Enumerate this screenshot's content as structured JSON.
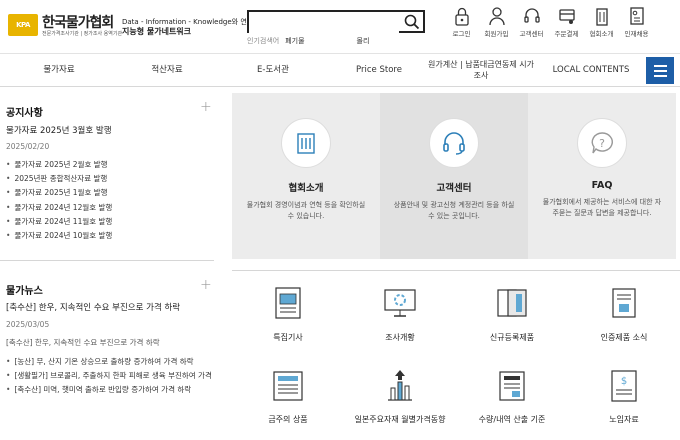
{
  "header": {
    "logo_badge": "사단법인",
    "logo_small": "사단법인",
    "logo_main": "한국물가협회",
    "logo_sub": "전문가격조사기관 | 정가조사 용역기관",
    "tagline_1": "Data - Information - Knowledge와 연계된",
    "tagline_2": "지능형 물가네트워크",
    "search_placeholder": "",
    "popular_label": "인기검색어",
    "popular_keywords": [
      "폐기물",
      "",
      "몰리 "
    ],
    "utils": [
      {
        "label": "로그인",
        "icon": "lock-icon"
      },
      {
        "label": "회원가입",
        "icon": "user-icon"
      },
      {
        "label": "고객센터",
        "icon": "headset-icon"
      },
      {
        "label": "주문결제",
        "icon": "cart-icon"
      },
      {
        "label": "협회소개",
        "icon": "building-icon"
      },
      {
        "label": "인재채용",
        "icon": "document-icon"
      }
    ]
  },
  "nav": {
    "items": [
      "물가자료",
      "적산자료",
      "E-도서관",
      "Price Store",
      "원가계산 | 납품대금연동제 시가조사",
      "LOCAL CONTENTS"
    ]
  },
  "notice": {
    "title": "공지사항",
    "headline": "물가자료 2025년 3월호 발행",
    "date": "2025/02/20",
    "items": [
      "물가자료 2025년 2월호 발행",
      "2025년판 종합적산자료 발행",
      "물가자료 2025년 1월호 발행",
      "물가자료 2024년 12월호 발행",
      "물가자료 2024년 11월호 발행",
      "물가자료 2024년 10월호 발행"
    ]
  },
  "news": {
    "title": "물가뉴스",
    "headline": "[축수산] 한우, 지속적인 수요 부진으로 가격 하락",
    "date": "2025/03/05",
    "summary": "[축수산] 한우, 지속적인 수요 부진으로 가격 하락",
    "items": [
      "[농산] 무, 산지 기온 상승으로 출하량 증가하여 가격 하락",
      "[생활필가] 브로콜리, 주출하지 한파 피해로 생육 부진하여 가격...",
      "[축수산] 미역, 햇미역 출하로 반입량 증가하여 가격 하락"
    ]
  },
  "info_boxes": [
    {
      "title": "협회소개",
      "desc": "물가협회 경영이념과 연혁 등을 확인하실 수 있습니다.",
      "icon": "building-icon"
    },
    {
      "title": "고객센터",
      "desc": "상품안내 및 광고신청 계정관리 등을 하실 수 있는 곳입니다.",
      "icon": "headset-icon"
    },
    {
      "title": "FAQ",
      "desc": "물가협회에서 제공하는 서비스에 대한 자주묻는 질문과 답변을 제공합니다.",
      "icon": "question-icon"
    }
  ],
  "grid": [
    {
      "label": "특집기사",
      "icon": "article-icon"
    },
    {
      "label": "조사개황",
      "icon": "monitor-icon"
    },
    {
      "label": "신규등록제품",
      "icon": "catalog-icon"
    },
    {
      "label": "인증제품 소식",
      "icon": "certificate-icon"
    },
    {
      "label": "금주의 상품",
      "icon": "newspaper-icon"
    },
    {
      "label": "일본주요자재 월별가격동향",
      "icon": "chart-arrow-icon"
    },
    {
      "label": "수량/내역 산출 기준",
      "icon": "book-icon"
    },
    {
      "label": "노임자료",
      "icon": "receipt-icon"
    }
  ]
}
